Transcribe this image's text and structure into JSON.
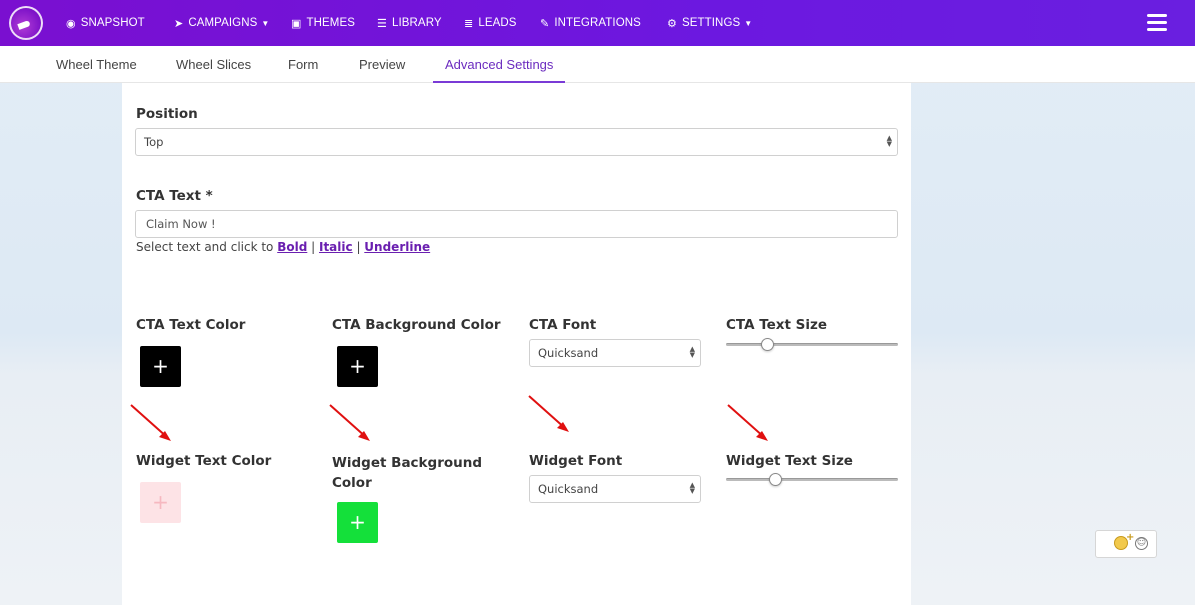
{
  "nav": {
    "items": [
      {
        "label": "SNAPSHOT",
        "icon": "dashboard-icon",
        "glyph": "◉"
      },
      {
        "label": "CAMPAIGNS",
        "icon": "paper-plane-icon",
        "glyph": "➤",
        "dropdown": true
      },
      {
        "label": "THEMES",
        "icon": "image-icon",
        "glyph": "▣"
      },
      {
        "label": "LIBRARY",
        "icon": "list-alt-icon",
        "glyph": "☰"
      },
      {
        "label": "LEADS",
        "icon": "list-icon",
        "glyph": "≣"
      },
      {
        "label": "INTEGRATIONS",
        "icon": "plug-icon",
        "glyph": "✎"
      },
      {
        "label": "SETTINGS",
        "icon": "cogs-icon",
        "glyph": "⚙",
        "dropdown": true
      }
    ],
    "caret": "▼"
  },
  "tabs": [
    {
      "label": "Wheel Theme"
    },
    {
      "label": "Wheel Slices"
    },
    {
      "label": "Form"
    },
    {
      "label": "Preview"
    },
    {
      "label": "Advanced Settings",
      "active": true
    }
  ],
  "form": {
    "position": {
      "label": "Position",
      "value": "Top"
    },
    "cta_text": {
      "label": "CTA Text *",
      "value": "Claim Now !",
      "helper_prefix": "Select text and click to ",
      "bold": "Bold",
      "italic": "Italic",
      "underline": "Underline",
      "sep": " | "
    },
    "cta_text_color": {
      "label": "CTA Text Color",
      "color": "#000000",
      "symbol": "+"
    },
    "cta_bg_color": {
      "label": "CTA Background Color",
      "color": "#000000",
      "symbol": "+"
    },
    "cta_font": {
      "label": "CTA Font",
      "value": "Quicksand"
    },
    "cta_text_size": {
      "label": "CTA Text Size",
      "level": 0.22
    },
    "widget_text_color": {
      "label": "Widget Text Color",
      "color": "#fde3e6",
      "symbol": "+"
    },
    "widget_bg_color": {
      "label_line1": "Widget Background",
      "label_line2": "Color",
      "color": "#14e03a",
      "symbol": "+"
    },
    "widget_font": {
      "label": "Widget Font",
      "value": "Quicksand"
    },
    "widget_text_size": {
      "label": "Widget Text Size",
      "level": 0.27
    }
  },
  "colors": {
    "accent": "#6b2bbf",
    "arrow": "#e01010",
    "nav_bg": "#7a0fd0"
  }
}
